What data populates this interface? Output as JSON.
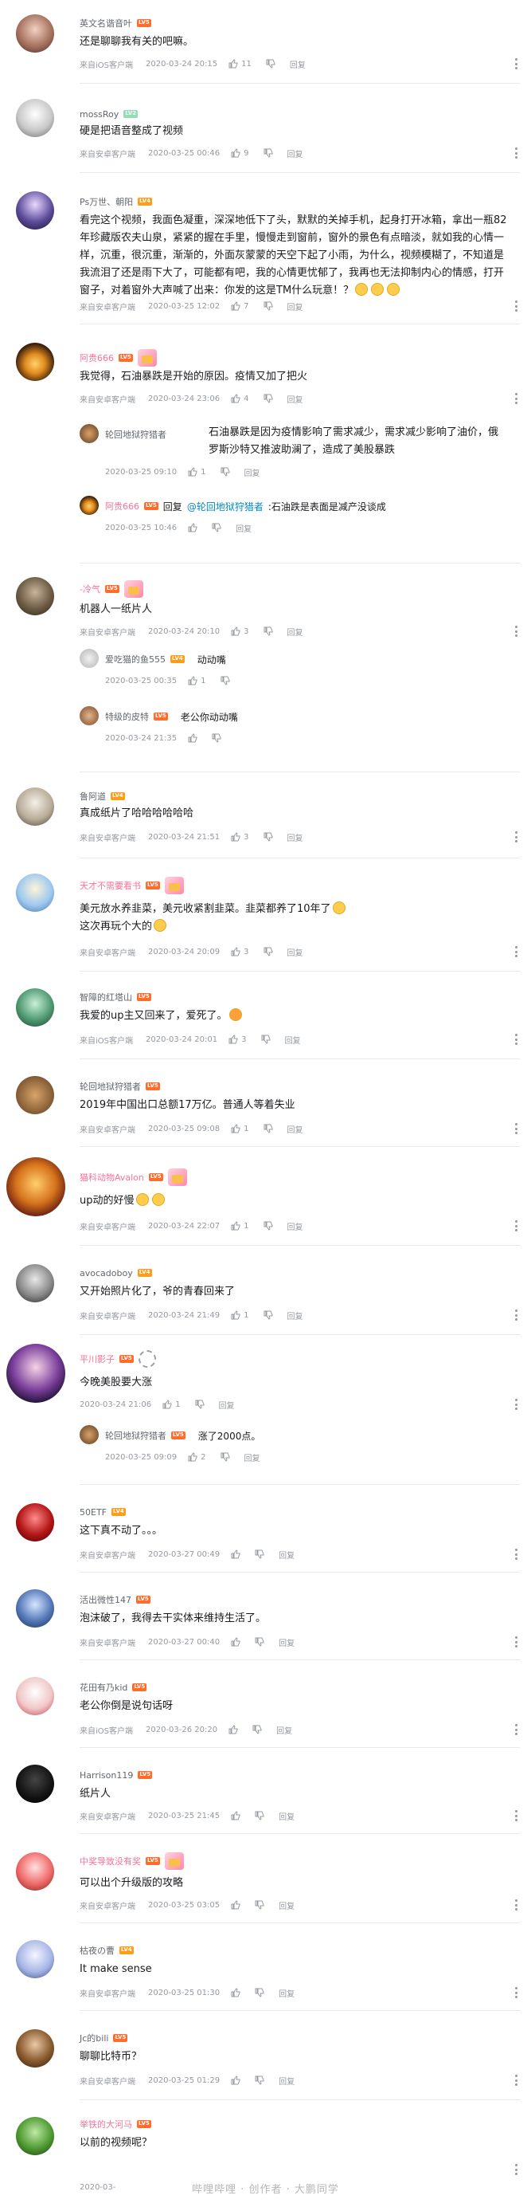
{
  "actions": {
    "reply_label": "回复"
  },
  "comments": [
    {
      "user": "英文名谐音叶",
      "level": "LV5",
      "text": "还是聊聊我有关的吧嘛。",
      "source": "来自iOS客户端",
      "time": "2020-03-24 20:15",
      "likes": "11"
    },
    {
      "user": "mossRoy",
      "level": "LV2",
      "text": "硬是把语音整成了视频",
      "source": "来自安卓客户端",
      "time": "2020-03-25 00:46",
      "likes": "9"
    },
    {
      "user": "Ps万世、朝阳",
      "level": "LV4",
      "text": "看完这个视频，我面色凝重，深深地低下了头，默默的关掉手机，起身打开冰箱，拿出一瓶82年珍藏版农夫山泉，紧紧的握在手里，慢慢走到窗前，窗外的景色有点暗淡，就如我的心情一样，沉重，很沉重，渐渐的，外面灰蒙蒙的天空下起了小雨，为什么，视频模糊了，不知道是我流泪了还是雨下大了，可能都有吧，我的心情更忧郁了，我再也无法抑制内心的情感，打开窗子，对着窗外大声喊了出来：你发的这是TM什么玩意！？",
      "source": "来自安卓客户端",
      "time": "2020-03-25 12:02",
      "likes": "7"
    },
    {
      "user": "阿贵666",
      "level": "LV5",
      "text": "我觉得，石油暴跌是开始的原因。疫情又加了把火",
      "source": "来自安卓客户端",
      "time": "2020-03-24 23:06",
      "likes": "4"
    },
    {
      "user": "轮回地狱狩猎者",
      "level": "",
      "text": "石油暴跌是因为疫情影响了需求减少，需求减少影响了油价，俄罗斯沙特又推波助澜了，造成了美股暴跌",
      "source": "",
      "time": "2020-03-25 09:10",
      "likes": "1"
    },
    {
      "user": "阿贵666",
      "level": "LV5",
      "reply_prefix": "回复",
      "reply_to": "@轮回地狱狩猎者",
      "text": ":石油跌是表面是减产没谈成",
      "source": "",
      "time": "2020-03-25 10:46",
      "likes": ""
    },
    {
      "user": "-冷气",
      "level": "LV5",
      "text": "机器人一纸片人",
      "source": "来自安卓客户端",
      "time": "2020-03-24 20:10",
      "likes": "3"
    },
    {
      "user": "爱吃猫的鱼555",
      "level": "LV4",
      "text": "动动嘴",
      "source": "",
      "time": "2020-03-25 00:35",
      "likes": "1"
    },
    {
      "user": "特级的皮特",
      "level": "LV5",
      "text": "老公你动动嘴",
      "source": "",
      "time": "2020-03-24 21:35",
      "likes": ""
    },
    {
      "user": "鲁阿道",
      "level": "LV4",
      "text": "真成纸片了哈哈哈哈哈哈",
      "source": "来自安卓客户端",
      "time": "2020-03-24 21:51",
      "likes": "3"
    },
    {
      "user": "天才不需要看书",
      "level": "LV5",
      "text": "美元放水养韭菜，美元收紧割韭菜。韭菜都养了10年了",
      "text2": "这次再玩个大的",
      "source": "来自安卓客户端",
      "time": "2020-03-24 20:09",
      "likes": "3"
    },
    {
      "user": "智障的红塔山",
      "level": "LV5",
      "text": "我爱的up主又回来了，爱死了。",
      "source": "来自iOS客户端",
      "time": "2020-03-24 20:01",
      "likes": "3"
    },
    {
      "user": "轮回地狱狩猎者",
      "level": "LV5",
      "text": "2019年中国出口总额17万亿。普通人等着失业",
      "source": "来自安卓客户端",
      "time": "2020-03-25 09:08",
      "likes": "1"
    },
    {
      "user": "猫科动物Avalon",
      "level": "LV5",
      "text": "up动的好慢",
      "source": "来自安卓客户端",
      "time": "2020-03-24 22:07",
      "likes": "1"
    },
    {
      "user": "avocadoboy",
      "level": "LV4",
      "text": "又开始照片化了，爷的青春回来了",
      "source": "来自安卓客户端",
      "time": "2020-03-24 21:49",
      "likes": "1"
    },
    {
      "user": "平川影子",
      "level": "LV5",
      "text": "今晚美股要大涨",
      "source": "",
      "time": "2020-03-24 21:06",
      "likes": "1"
    },
    {
      "user": "轮回地狱狩猎者",
      "level": "LV5",
      "text": "涨了2000点。",
      "source": "",
      "time": "2020-03-25 09:09",
      "likes": "2"
    },
    {
      "user": "50ETF",
      "level": "LV4",
      "text": "这下真不动了。。。",
      "source": "来自安卓客户端",
      "time": "2020-03-27 00:49",
      "likes": ""
    },
    {
      "user": "活出微性147",
      "level": "LV5",
      "text": "泡沫破了，我得去干实体来维持生活了。",
      "source": "来自安卓客户端",
      "time": "2020-03-27 00:40",
      "likes": ""
    },
    {
      "user": "花田有乃kid",
      "level": "LV5",
      "text": "老公你倒是说句话呀",
      "source": "来自iOS客户端",
      "time": "2020-03-26 20:20",
      "likes": ""
    },
    {
      "user": "Harrison119",
      "level": "LV5",
      "text": "纸片人",
      "source": "来自安卓客户端",
      "time": "2020-03-25 21:45",
      "likes": ""
    },
    {
      "user": "中奖导致没有奖",
      "level": "LV5",
      "text": "可以出个升级版的攻略",
      "source": "来自安卓客户端",
      "time": "2020-03-25 03:05",
      "likes": ""
    },
    {
      "user": "枯夜の曹",
      "level": "LV4",
      "text": "It make sense",
      "source": "来自安卓客户端",
      "time": "2020-03-25 01:30",
      "likes": ""
    },
    {
      "user": "Jc的bili",
      "level": "LV5",
      "text": "聊聊比特币？",
      "source": "来自安卓客户端",
      "time": "2020-03-25 01:29",
      "likes": ""
    },
    {
      "user": "举铁的大河马",
      "level": "LV5",
      "text": "以前的视频呢？",
      "source": "",
      "time": "2020-03-",
      "likes": ""
    }
  ],
  "watermark": "哔哩哔哩 · 创作者 · 大鹏同学",
  "colors": {
    "vip_name": "#fb7299",
    "link": "#008ac5",
    "meta": "#9499a0"
  }
}
